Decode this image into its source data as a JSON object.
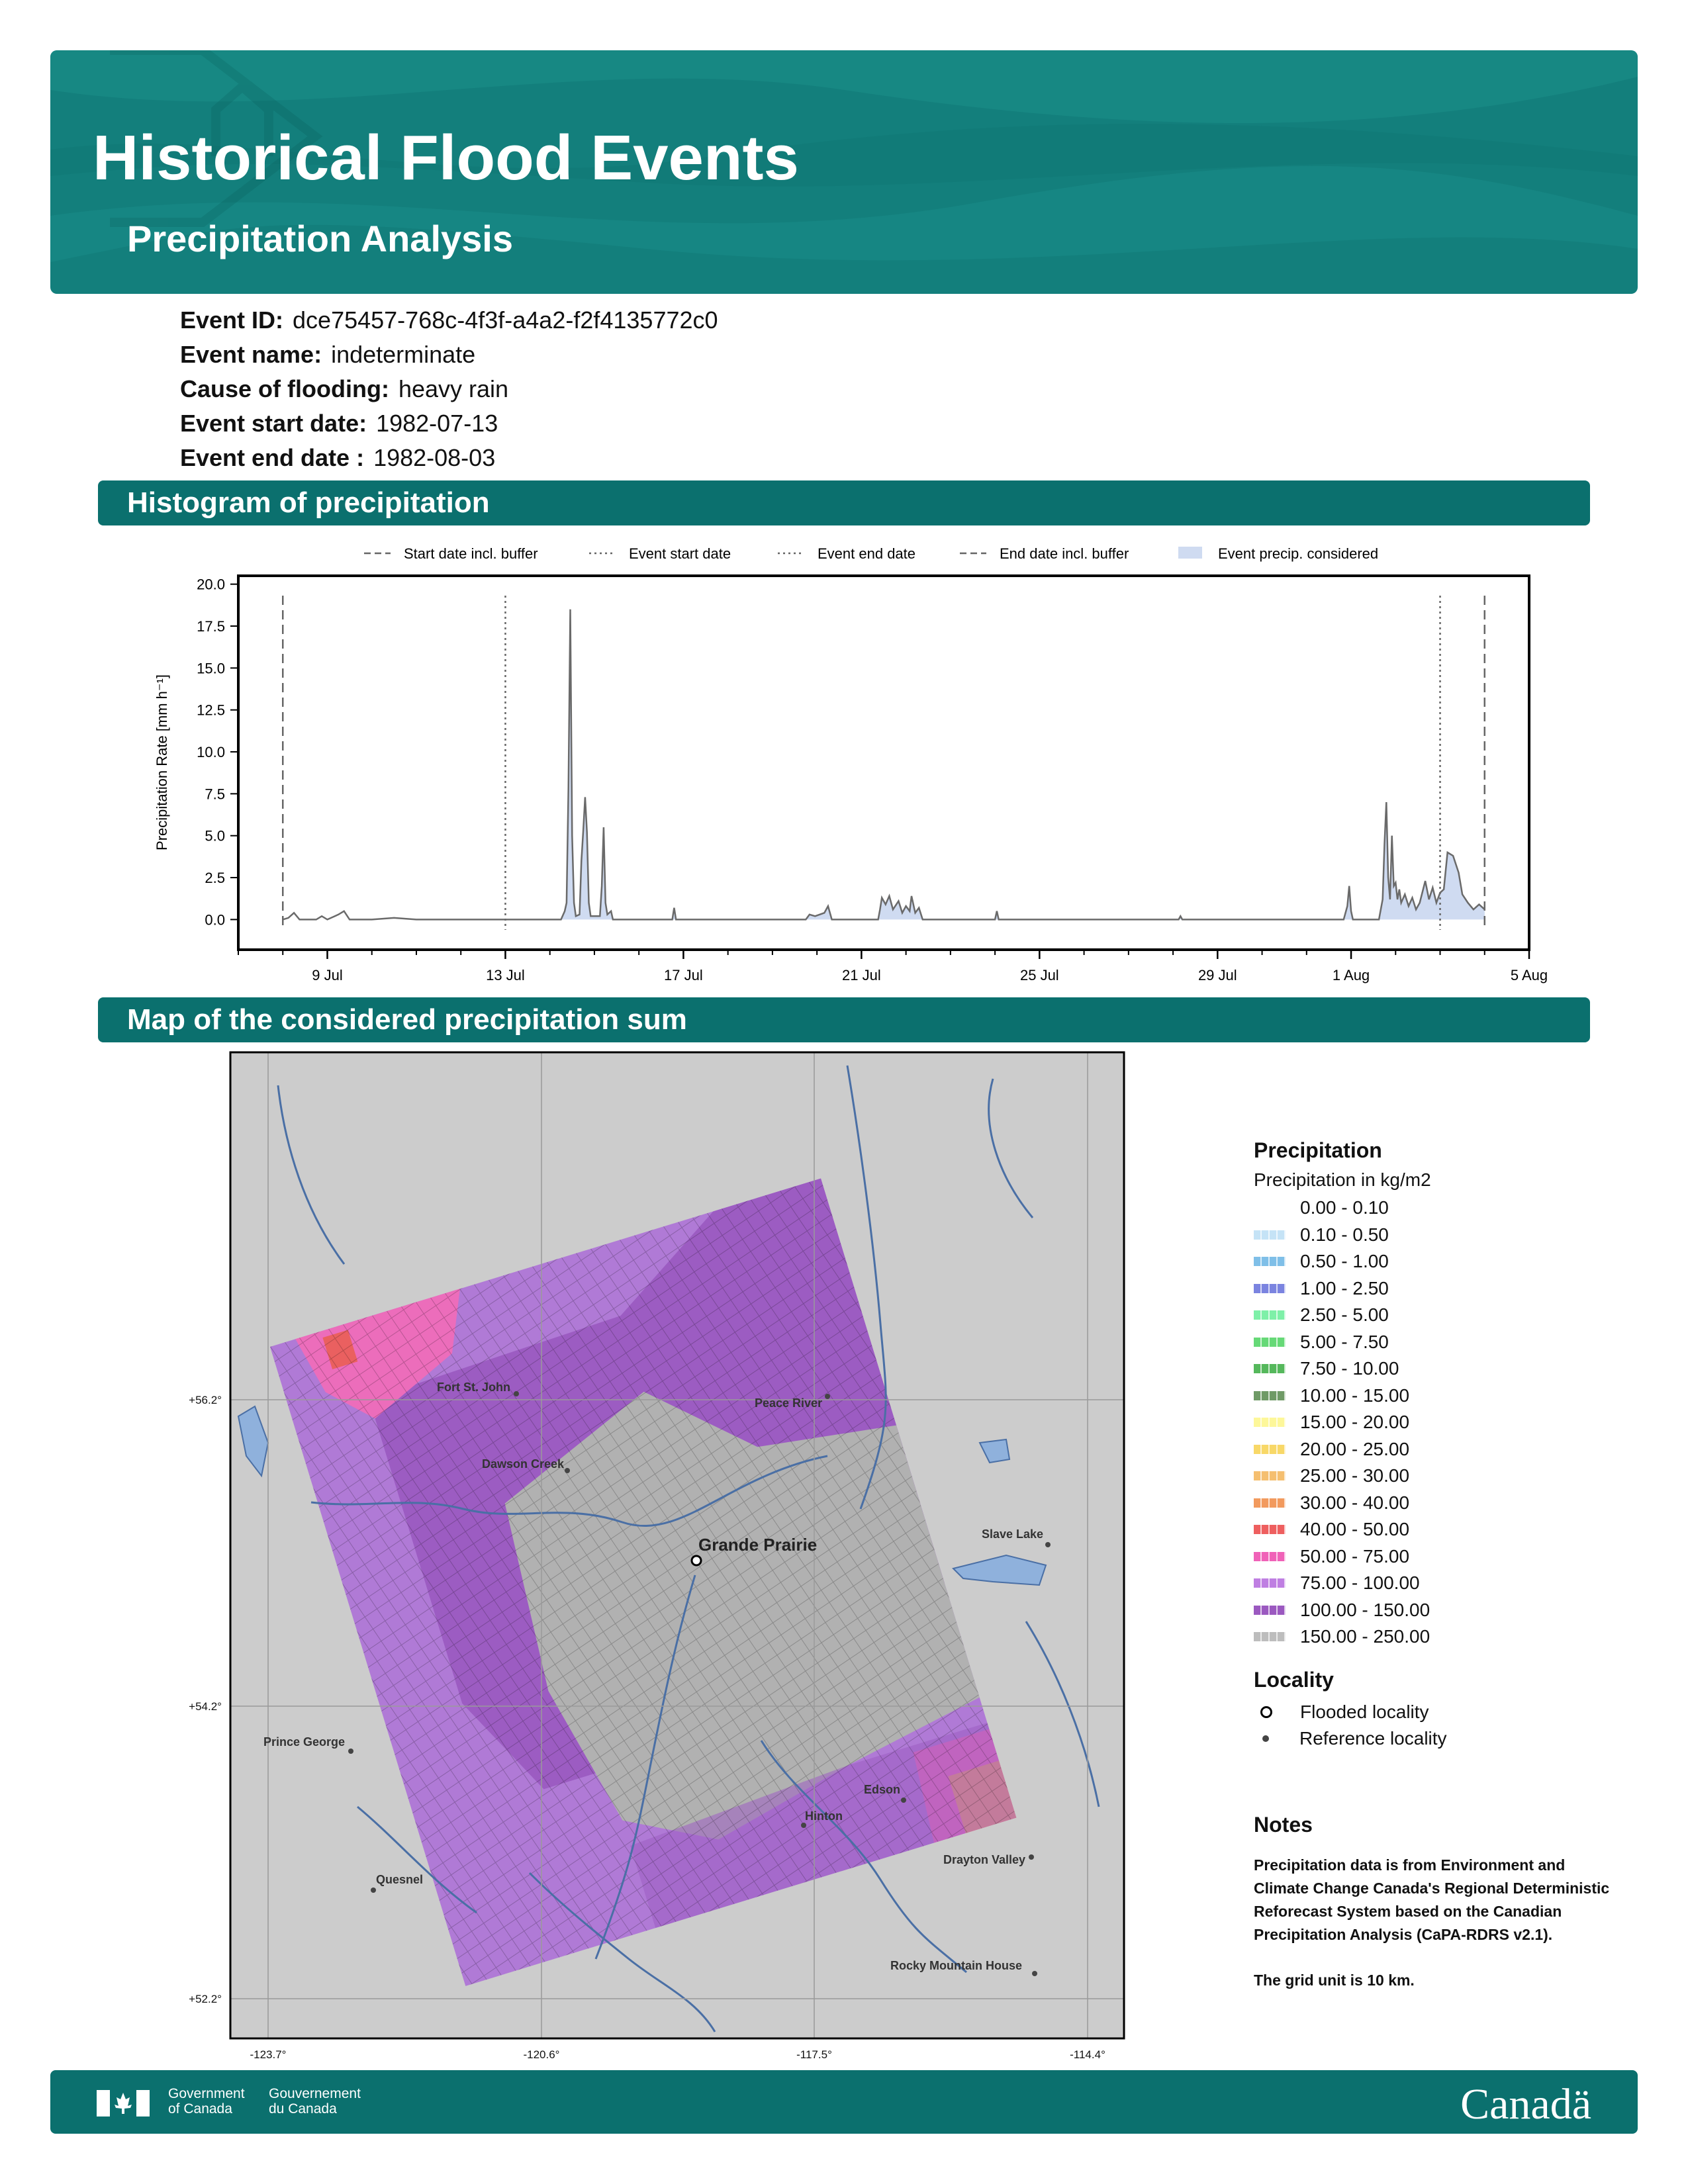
{
  "header": {
    "title": "Historical Flood Events",
    "subtitle": "Precipitation Analysis"
  },
  "event": [
    {
      "label": "Event ID:",
      "value": "dce75457-768c-4f3f-a4a2-f2f4135772c0"
    },
    {
      "label": "Event name:",
      "value": "indeterminate"
    },
    {
      "label": "Cause of flooding:",
      "value": "heavy rain"
    },
    {
      "label": "Event start date:",
      "value": "1982-07-13"
    },
    {
      "label": "Event end date :",
      "value": "1982-08-03"
    }
  ],
  "sections": {
    "histogram": "Histogram of precipitation",
    "map": "Map of the considered precipitation sum"
  },
  "chart_data": {
    "type": "area",
    "ylabel": "Precipitation Rate [mm h⁻¹]",
    "xlabel": "",
    "ylim": [
      -1.8,
      20.5
    ],
    "yticks": [
      "0.0",
      "2.5",
      "5.0",
      "7.5",
      "10.0",
      "12.5",
      "15.0",
      "17.5",
      "20.0"
    ],
    "xticks": [
      {
        "date": "1982-07-09",
        "label": "9 Jul"
      },
      {
        "date": "1982-07-13",
        "label": "13 Jul"
      },
      {
        "date": "1982-07-17",
        "label": "17 Jul"
      },
      {
        "date": "1982-07-21",
        "label": "21 Jul"
      },
      {
        "date": "1982-07-25",
        "label": "25 Jul"
      },
      {
        "date": "1982-07-29",
        "label": "29 Jul"
      },
      {
        "date": "1982-08-01",
        "label": "1 Aug"
      },
      {
        "date": "1982-08-05",
        "label": "5 Aug"
      }
    ],
    "xlim": [
      "1982-07-07T00:00",
      "1982-08-05T00:00"
    ],
    "legend": [
      {
        "label": "Start date incl. buffer",
        "style": "dashed"
      },
      {
        "label": "Event start date",
        "style": "dotted"
      },
      {
        "label": "Event end date",
        "style": "dotted"
      },
      {
        "label": "End date incl. buffer",
        "style": "dashed"
      },
      {
        "label": "Event precip. considered",
        "style": "fill"
      }
    ],
    "legend_position": "top",
    "vlines": {
      "start_buffer": "1982-07-08T00:00",
      "event_start": "1982-07-13T00:00",
      "event_end": "1982-08-03T00:00",
      "end_buffer": "1982-08-04T00:00"
    },
    "series": [
      {
        "name": "Precipitation Rate",
        "points": [
          [
            "1982-07-08T00:00",
            0
          ],
          [
            "1982-07-08T03:00",
            0.1
          ],
          [
            "1982-07-08T06:00",
            0.4
          ],
          [
            "1982-07-08T09:00",
            0
          ],
          [
            "1982-07-08T18:00",
            0
          ],
          [
            "1982-07-08T21:00",
            0.2
          ],
          [
            "1982-07-09T00:00",
            0
          ],
          [
            "1982-07-09T06:00",
            0.3
          ],
          [
            "1982-07-09T09:00",
            0.5
          ],
          [
            "1982-07-09T12:00",
            0
          ],
          [
            "1982-07-10T00:00",
            0
          ],
          [
            "1982-07-10T12:00",
            0.1
          ],
          [
            "1982-07-11T00:00",
            0
          ],
          [
            "1982-07-13T00:00",
            0
          ],
          [
            "1982-07-14T06:00",
            0
          ],
          [
            "1982-07-14T08:00",
            0.5
          ],
          [
            "1982-07-14T09:00",
            1.0
          ],
          [
            "1982-07-14T10:00",
            7.8
          ],
          [
            "1982-07-14T11:00",
            18.5
          ],
          [
            "1982-07-14T12:00",
            5.0
          ],
          [
            "1982-07-14T13:00",
            1.0
          ],
          [
            "1982-07-14T14:00",
            0.2
          ],
          [
            "1982-07-14T16:00",
            0.3
          ],
          [
            "1982-07-14T17:00",
            3.5
          ],
          [
            "1982-07-14T18:00",
            5.3
          ],
          [
            "1982-07-14T19:00",
            7.3
          ],
          [
            "1982-07-14T20:00",
            5.2
          ],
          [
            "1982-07-14T21:00",
            1.0
          ],
          [
            "1982-07-14T22:00",
            0.2
          ],
          [
            "1982-07-15T03:00",
            0.2
          ],
          [
            "1982-07-15T04:00",
            2.0
          ],
          [
            "1982-07-15T05:00",
            5.5
          ],
          [
            "1982-07-15T06:00",
            1.0
          ],
          [
            "1982-07-15T07:00",
            0.3
          ],
          [
            "1982-07-15T09:00",
            0.5
          ],
          [
            "1982-07-15T10:00",
            0
          ],
          [
            "1982-07-16T18:00",
            0
          ],
          [
            "1982-07-16T19:00",
            0.7
          ],
          [
            "1982-07-16T20:00",
            0
          ],
          [
            "1982-07-19T18:00",
            0
          ],
          [
            "1982-07-19T20:00",
            0.3
          ],
          [
            "1982-07-19T23:00",
            0.2
          ],
          [
            "1982-07-20T04:00",
            0.4
          ],
          [
            "1982-07-20T06:00",
            0.8
          ],
          [
            "1982-07-20T08:00",
            0
          ],
          [
            "1982-07-21T09:00",
            0
          ],
          [
            "1982-07-21T10:00",
            0.6
          ],
          [
            "1982-07-21T11:00",
            1.3
          ],
          [
            "1982-07-21T13:00",
            0.9
          ],
          [
            "1982-07-21T15:00",
            1.4
          ],
          [
            "1982-07-21T17:00",
            0.6
          ],
          [
            "1982-07-21T20:00",
            1.1
          ],
          [
            "1982-07-21T22:00",
            0.4
          ],
          [
            "1982-07-22T00:00",
            0.8
          ],
          [
            "1982-07-22T02:00",
            0.5
          ],
          [
            "1982-07-22T03:00",
            1.4
          ],
          [
            "1982-07-22T05:00",
            0.4
          ],
          [
            "1982-07-22T07:00",
            0.7
          ],
          [
            "1982-07-22T09:00",
            0
          ],
          [
            "1982-07-24T00:00",
            0
          ],
          [
            "1982-07-24T01:00",
            0.5
          ],
          [
            "1982-07-24T02:00",
            0
          ],
          [
            "1982-07-28T03:00",
            0
          ],
          [
            "1982-07-28T04:00",
            0.2
          ],
          [
            "1982-07-28T05:00",
            0
          ],
          [
            "1982-07-31T20:00",
            0
          ],
          [
            "1982-07-31T22:00",
            0.8
          ],
          [
            "1982-07-31T23:00",
            2.0
          ],
          [
            "1982-08-01T00:00",
            0.5
          ],
          [
            "1982-08-01T01:00",
            0
          ],
          [
            "1982-08-01T15:00",
            0
          ],
          [
            "1982-08-01T17:00",
            1.2
          ],
          [
            "1982-08-01T18:00",
            4.5
          ],
          [
            "1982-08-01T19:00",
            7.0
          ],
          [
            "1982-08-01T20:00",
            2.5
          ],
          [
            "1982-08-01T21:00",
            1.2
          ],
          [
            "1982-08-01T22:00",
            5.0
          ],
          [
            "1982-08-01T23:00",
            2.0
          ],
          [
            "1982-08-02T00:00",
            2.2
          ],
          [
            "1982-08-02T01:00",
            1.2
          ],
          [
            "1982-08-02T02:00",
            1.8
          ],
          [
            "1982-08-02T03:00",
            1.0
          ],
          [
            "1982-08-02T05:00",
            1.5
          ],
          [
            "1982-08-02T07:00",
            0.8
          ],
          [
            "1982-08-02T09:00",
            1.3
          ],
          [
            "1982-08-02T11:00",
            0.6
          ],
          [
            "1982-08-02T13:00",
            1.0
          ],
          [
            "1982-08-02T16:00",
            2.3
          ],
          [
            "1982-08-02T18:00",
            1.2
          ],
          [
            "1982-08-02T20:00",
            1.9
          ],
          [
            "1982-08-02T22:00",
            1.0
          ],
          [
            "1982-08-03T00:00",
            1.6
          ],
          [
            "1982-08-03T02:00",
            1.8
          ],
          [
            "1982-08-03T04:00",
            4.0
          ],
          [
            "1982-08-03T07:00",
            3.8
          ],
          [
            "1982-08-03T10:00",
            2.8
          ],
          [
            "1982-08-03T12:00",
            1.5
          ],
          [
            "1982-08-03T15:00",
            1.0
          ],
          [
            "1982-08-03T18:00",
            0.6
          ],
          [
            "1982-08-03T21:00",
            0.9
          ],
          [
            "1982-08-04T00:00",
            0.6
          ]
        ]
      }
    ],
    "fill_range": [
      "1982-07-13T00:00",
      "1982-08-04T00:00"
    ]
  },
  "map": {
    "lon_ticks": [
      "-123.7°",
      "-120.6°",
      "-117.5°",
      "-114.4°"
    ],
    "lat_ticks": [
      "+56.2°",
      "+54.2°",
      "+52.2°"
    ],
    "places": [
      {
        "name": "Fort St. John",
        "type": "reference"
      },
      {
        "name": "Peace River",
        "type": "reference"
      },
      {
        "name": "Dawson Creek",
        "type": "reference"
      },
      {
        "name": "Grande Prairie",
        "type": "flooded"
      },
      {
        "name": "Slave Lake",
        "type": "reference"
      },
      {
        "name": "Prince George",
        "type": "reference"
      },
      {
        "name": "Edson",
        "type": "reference"
      },
      {
        "name": "Hinton",
        "type": "reference"
      },
      {
        "name": "Drayton Valley",
        "type": "reference"
      },
      {
        "name": "Quesnel",
        "type": "reference"
      },
      {
        "name": "Rocky Mountain House",
        "type": "reference"
      }
    ],
    "colors": {
      "background": "#cccccc",
      "river": "#4a6fa5",
      "lake": "#8fb1dc"
    }
  },
  "legend": {
    "title": "Precipitation",
    "subtitle": "Precipitation in kg/m2",
    "bins": [
      {
        "label": "0.00 - 0.10",
        "color": "#ffffff"
      },
      {
        "label": "0.10 - 0.50",
        "color": "#c5e3f6"
      },
      {
        "label": "0.50 - 1.00",
        "color": "#7fbfe8"
      },
      {
        "label": "1.00 - 2.50",
        "color": "#7b84e0"
      },
      {
        "label": "2.50 - 5.00",
        "color": "#7ef0a8"
      },
      {
        "label": "5.00 - 7.50",
        "color": "#66d977"
      },
      {
        "label": "7.50 - 10.00",
        "color": "#55b85c"
      },
      {
        "label": "10.00 - 15.00",
        "color": "#6f9a66"
      },
      {
        "label": "15.00 - 20.00",
        "color": "#fdf79a"
      },
      {
        "label": "20.00 - 25.00",
        "color": "#f8d868"
      },
      {
        "label": "25.00 - 30.00",
        "color": "#f5bf70"
      },
      {
        "label": "30.00 - 40.00",
        "color": "#f29a5e"
      },
      {
        "label": "40.00 - 50.00",
        "color": "#ee5f5f"
      },
      {
        "label": "50.00 - 75.00",
        "color": "#f062b8"
      },
      {
        "label": "75.00 - 100.00",
        "color": "#bf7fe2"
      },
      {
        "label": "100.00 - 150.00",
        "color": "#9b59c0"
      },
      {
        "label": "150.00 - 250.00",
        "color": "#bdbdbd"
      }
    ],
    "locality_title": "Locality",
    "flooded": "Flooded locality",
    "reference": "Reference locality"
  },
  "notes": {
    "title": "Notes",
    "text1": "Precipitation data is from Environment and Climate Change Canada's Regional Deterministic Reforecast System based on the Canadian Precipitation Analysis (CaPA-RDRS v2.1).",
    "text2": "The grid unit is 10 km."
  },
  "footer": {
    "gov_en": [
      "Government",
      "of Canada"
    ],
    "gov_fr": [
      "Gouvernement",
      "du Canada"
    ],
    "wordmark": "Canadä"
  }
}
